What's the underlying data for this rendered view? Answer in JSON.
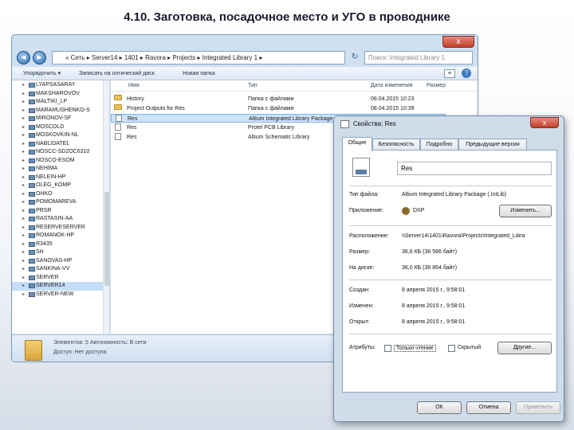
{
  "slide": {
    "title": "4.10. Заготовка, посадочное место и УГО в проводнике"
  },
  "explorer": {
    "close_glyph": "x",
    "back_glyph": "◄",
    "forward_glyph": "►",
    "address": "« Сеть ▸ Server14 ▸ 1401 ▸ Ravora ▸ Projects ▸ Integrated Library 1 ▸",
    "refresh_glyph": "↻",
    "search_placeholder": "Поиск: Integrated Library 1",
    "toolbar": {
      "organize": "Упорядочить ▾",
      "burn": "Записать на оптический диск",
      "new_folder": "Новая папка",
      "views": "≡",
      "help": "?"
    },
    "tree": [
      "LYAPSASARAY",
      "MAKSHAROVOV",
      "MALTIKI_LP",
      "MARAMUSHENKO-S",
      "MIRONOV-SF",
      "MOSCOLD",
      "MOSKOVKIN-NL",
      "NABLIDATEL",
      "NOSCC-SD2OC6310",
      "NOSCO-ESOM",
      "NEHIMA",
      "NELEIN-HP",
      "OLEG_KOMP",
      "OHKO",
      "POMOMAREVA",
      "PRSR",
      "RASTASIN-AA",
      "RESERVESERVER",
      "ROMANOK-HP",
      "R3435",
      "SH",
      "SANOVAS-HP",
      "SANKINA-VV",
      "SERVER",
      "SERVER14",
      "SERVER-NEW"
    ],
    "tree_selected": 24,
    "columns": {
      "name": "Имя",
      "type": "Тип",
      "date": "Дата изменения",
      "size": "Размер"
    },
    "files": [
      {
        "name": "History",
        "type": "Папка с файлами",
        "date": "08.04.2015 10:23",
        "size": "",
        "kind": "folder"
      },
      {
        "name": "Project Outputs for Res",
        "type": "Папка с файлами",
        "date": "08.04.2015 10:39",
        "size": "",
        "kind": "folder"
      },
      {
        "name": "Res",
        "type": "Altium Integrated Library Package",
        "date": "08.04.2015 9:58",
        "size": "37 КБ",
        "kind": "doc"
      },
      {
        "name": "Res",
        "type": "Protel PCB Library",
        "date": "",
        "size": "",
        "kind": "doc"
      },
      {
        "name": "Res",
        "type": "Altium Schematic Library",
        "date": "",
        "size": "",
        "kind": "doc"
      }
    ],
    "files_selected": 2,
    "details": {
      "line1": "Элементов: 5   Автономность: В сети",
      "line2": "Доступ: Нет доступа"
    }
  },
  "properties": {
    "title": "Свойства: Res",
    "close_glyph": "x",
    "tabs": [
      "Общие",
      "Безопасность",
      "Подробно",
      "Предыдущие версии"
    ],
    "active_tab": 0,
    "name_value": "Res",
    "file_type_label": "Тип файла:",
    "file_type_value": "Altium Integrated Library Package (.IntLib)",
    "app_label": "Приложение:",
    "app_value": "DXP",
    "change_button": "Изменить...",
    "location_label": "Расположение:",
    "location_value": "\\\\Server14\\1401\\Ravora\\Projects\\Integrated_Libra",
    "size_label": "Размер:",
    "size_value": "36,6 КБ (36 586 байт)",
    "disk_label": "На диске:",
    "disk_value": "36,0 КБ (36 864 байт)",
    "created_label": "Создан:",
    "created_value": "8 апреля 2015 г., 9:58:01",
    "modified_label": "Изменен:",
    "modified_value": "8 апреля 2015 г., 9:58:01",
    "opened_label": "Открыт:",
    "opened_value": "8 апреля 2015 г., 9:58:01",
    "attributes_label": "Атрибуты:",
    "readonly_label": "Только чтение",
    "hidden_label": "Скрытый",
    "other_button": "Другие...",
    "ok_button": "ОК",
    "cancel_button": "Отмена",
    "apply_button": "Применить"
  }
}
